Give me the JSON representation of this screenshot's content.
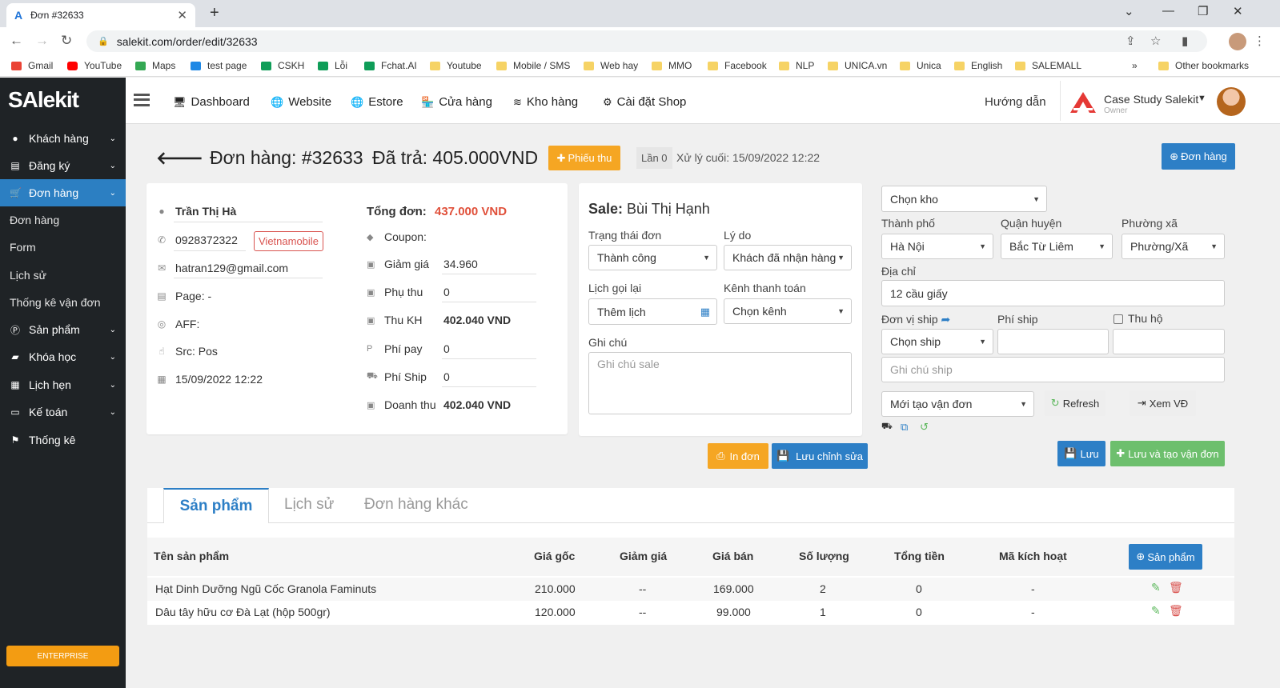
{
  "browser": {
    "tab_title": "Đơn #32633",
    "url": "salekit.com/order/edit/32633",
    "bookmarks": [
      "Gmail",
      "YouTube",
      "Maps",
      "test page",
      "CSKH",
      "Lỗi",
      "Fchat.AI",
      "Youtube",
      "Mobile / SMS",
      "Web hay",
      "MMO",
      "Facebook",
      "NLP",
      "UNICA.vn",
      "Unica",
      "English",
      "SALEMALL"
    ],
    "other_bookmarks": "Other bookmarks",
    "more": "»"
  },
  "sidebar": {
    "logo": "SAlekit",
    "items": [
      {
        "label": "Khách hàng",
        "icon": "user-icon"
      },
      {
        "label": "Đăng ký",
        "icon": "list-icon"
      },
      {
        "label": "Đơn hàng",
        "icon": "cart-icon",
        "active": true
      },
      {
        "label": "Sản phẩm",
        "icon": "product-icon"
      },
      {
        "label": "Khóa học",
        "icon": "book-icon"
      },
      {
        "label": "Lịch hẹn",
        "icon": "calendar-icon"
      },
      {
        "label": "Kế toán",
        "icon": "card-icon"
      },
      {
        "label": "Thống kê",
        "icon": "flag-icon"
      }
    ],
    "subitems": [
      "Đơn hàng",
      "Form",
      "Lịch sử",
      "Thống kê vận đơn"
    ],
    "enterprise": "ENTERPRISE"
  },
  "header": {
    "nav": [
      "Dashboard",
      "Website",
      "Estore",
      "Cửa hàng",
      "Kho hàng",
      "Cài đặt Shop"
    ],
    "help": "Hướng dẫn",
    "account_name": "Case Study Salekit",
    "account_role": "Owner"
  },
  "order": {
    "title": "Đơn hàng: #32633",
    "paid": "Đã trả: 405.000VND",
    "receipt_button": "Phiếu thu",
    "attempt": "Lần 0",
    "last_processed": "Xử lý cuối: 15/09/2022 12:22",
    "new_order_button": "Đơn hàng"
  },
  "customer": {
    "name": "Trần Thị Hà",
    "phone": "0928372322",
    "carrier": "Vietnamobile",
    "email": "hatran129@gmail.com",
    "page": "Page: -",
    "aff": "AFF:",
    "src": "Src: Pos",
    "date": "15/09/2022 12:22"
  },
  "totals": {
    "total_label": "Tổng đơn:",
    "total_value": "437.000 VND",
    "coupon_label": "Coupon:",
    "discount_label": "Giảm giá",
    "discount_value": "34.960",
    "surcharge_label": "Phụ thu",
    "surcharge_value": "0",
    "collected_label": "Thu KH",
    "collected_value": "402.040 VND",
    "payfee_label": "Phí pay",
    "payfee_value": "0",
    "shipfee_label": "Phí Ship",
    "shipfee_value": "0",
    "revenue_label": "Doanh thu",
    "revenue_value": "402.040 VND"
  },
  "sale": {
    "label": "Sale:",
    "name": "Bùi Thị Hạnh",
    "status_label": "Trạng thái đơn",
    "status_value": "Thành công",
    "reason_label": "Lý do",
    "reason_value": "Khách đã nhận hàng",
    "callback_label": "Lịch gọi lại",
    "callback_value": "Thêm lịch",
    "payment_label": "Kênh thanh toán",
    "payment_value": "Chọn kênh",
    "note_label": "Ghi chú",
    "note_placeholder": "Ghi chú sale",
    "print_button": "In đơn",
    "save_edit_button": "Lưu chỉnh sửa"
  },
  "shipping": {
    "warehouse": "Chọn kho",
    "city_label": "Thành phố",
    "city_value": "Hà Nội",
    "district_label": "Quận huyện",
    "district_value": "Bắc Từ Liêm",
    "ward_label": "Phường xã",
    "ward_value": "Phường/Xã",
    "address_label": "Địa chỉ",
    "address_value": "12 cầu giấy",
    "carrier_label": "Đơn vị ship",
    "carrier_value": "Chọn ship",
    "fee_label": "Phí ship",
    "cod_label": "Thu hộ",
    "note_placeholder": "Ghi chú ship",
    "waybill_status": "Mới tạo vận đơn",
    "refresh_button": "Refresh",
    "view_button": "Xem VĐ",
    "save_button": "Lưu",
    "save_create_button": "Lưu và tạo vận đơn"
  },
  "tabs": [
    "Sản phẩm",
    "Lịch sử",
    "Đơn hàng khác"
  ],
  "products": {
    "columns": [
      "Tên sản phẩm",
      "Giá gốc",
      "Giảm giá",
      "Giá bán",
      "Số lượng",
      "Tổng tiền",
      "Mã kích hoạt"
    ],
    "add_button": "Sản phẩm",
    "rows": [
      {
        "name": "Hạt Dinh Dưỡng Ngũ Cốc Granola Faminuts",
        "base": "210.000",
        "discount": "--",
        "price": "169.000",
        "qty": "2",
        "total": "0",
        "code": "-"
      },
      {
        "name": "Dâu tây hữu cơ Đà Lạt (hộp 500gr)",
        "base": "120.000",
        "discount": "--",
        "price": "99.000",
        "qty": "1",
        "total": "0",
        "code": "-"
      }
    ]
  }
}
